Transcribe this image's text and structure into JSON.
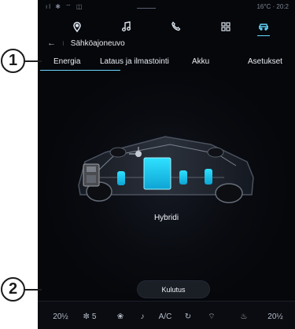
{
  "status": {
    "left_icons": "ıl ✱ ⌔ ◫",
    "right": "16°C · 20:2"
  },
  "nav_icons": [
    {
      "name": "location-pin-icon"
    },
    {
      "name": "music-note-icon"
    },
    {
      "name": "phone-icon"
    },
    {
      "name": "apps-grid-icon"
    },
    {
      "name": "car-icon"
    }
  ],
  "breadcrumb": {
    "back_icon": "←",
    "title": "Sähköajoneuvo"
  },
  "tabs": [
    "Energia",
    "Lataus ja ilmastointi",
    "Akku",
    "Asetukset"
  ],
  "main": {
    "mode_label": "Hybridi",
    "kulutus_label": "Kulutus"
  },
  "bottom_bar": {
    "left_temp": "20½",
    "fan_speed": "5",
    "ac_label": "A/C",
    "right_temp": "20½"
  },
  "callouts": [
    "1",
    "2"
  ],
  "colors": {
    "accent": "#6fd8ff",
    "battery": "#1ec8f8",
    "background": "#05070b"
  }
}
